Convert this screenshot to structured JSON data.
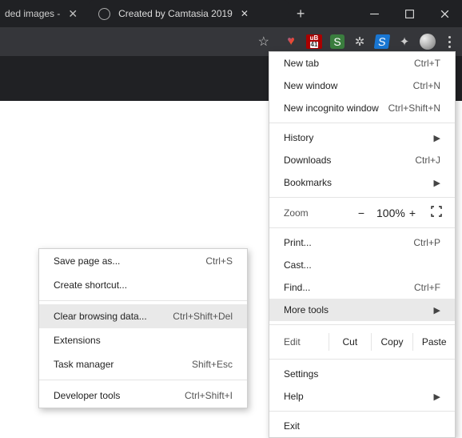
{
  "titlebar": {
    "tab_frag_text": "ded images -",
    "tab2_title": "Created by Camtasia 2019"
  },
  "main_menu": {
    "new_tab": {
      "label": "New tab",
      "shortcut": "Ctrl+T"
    },
    "new_window": {
      "label": "New window",
      "shortcut": "Ctrl+N"
    },
    "new_incognito": {
      "label": "New incognito window",
      "shortcut": "Ctrl+Shift+N"
    },
    "history": {
      "label": "History"
    },
    "downloads": {
      "label": "Downloads",
      "shortcut": "Ctrl+J"
    },
    "bookmarks": {
      "label": "Bookmarks"
    },
    "zoom": {
      "label": "Zoom",
      "minus": "−",
      "value": "100%",
      "plus": "+"
    },
    "print": {
      "label": "Print...",
      "shortcut": "Ctrl+P"
    },
    "cast": {
      "label": "Cast..."
    },
    "find": {
      "label": "Find...",
      "shortcut": "Ctrl+F"
    },
    "more_tools": {
      "label": "More tools"
    },
    "edit_row": {
      "label": "Edit",
      "cut": "Cut",
      "copy": "Copy",
      "paste": "Paste"
    },
    "settings": {
      "label": "Settings"
    },
    "help": {
      "label": "Help"
    },
    "exit": {
      "label": "Exit"
    }
  },
  "sub_menu": {
    "save_page": {
      "label": "Save page as...",
      "shortcut": "Ctrl+S"
    },
    "create_shortcut": {
      "label": "Create shortcut..."
    },
    "clear_data": {
      "label": "Clear browsing data...",
      "shortcut": "Ctrl+Shift+Del"
    },
    "extensions": {
      "label": "Extensions"
    },
    "task_manager": {
      "label": "Task manager",
      "shortcut": "Shift+Esc"
    },
    "developer_tools": {
      "label": "Developer tools",
      "shortcut": "Ctrl+Shift+I"
    }
  },
  "ext_labels": {
    "ub_top": "uB",
    "ub_num": "41",
    "s": "S"
  }
}
